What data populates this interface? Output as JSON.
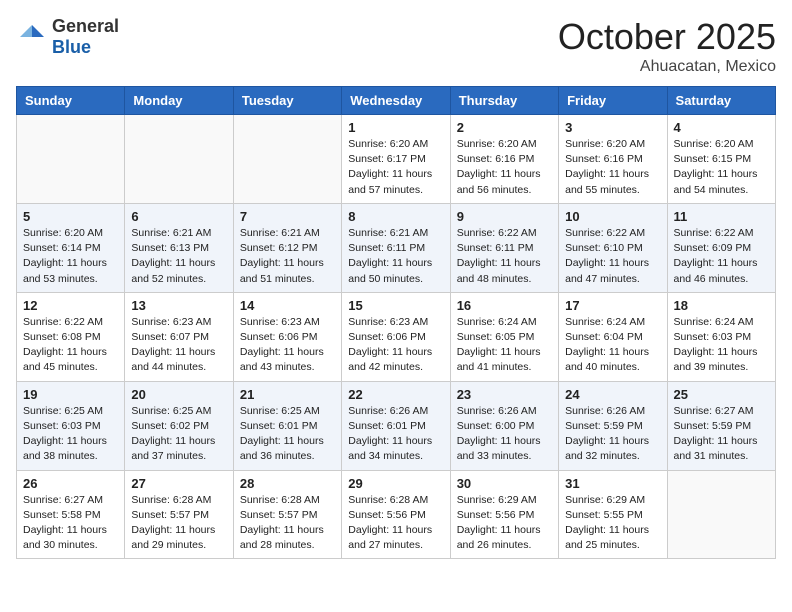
{
  "header": {
    "logo_general": "General",
    "logo_blue": "Blue",
    "month": "October 2025",
    "location": "Ahuacatan, Mexico"
  },
  "days_of_week": [
    "Sunday",
    "Monday",
    "Tuesday",
    "Wednesday",
    "Thursday",
    "Friday",
    "Saturday"
  ],
  "weeks": [
    [
      {
        "day": "",
        "sunrise": "",
        "sunset": "",
        "daylight": ""
      },
      {
        "day": "",
        "sunrise": "",
        "sunset": "",
        "daylight": ""
      },
      {
        "day": "",
        "sunrise": "",
        "sunset": "",
        "daylight": ""
      },
      {
        "day": "1",
        "sunrise": "Sunrise: 6:20 AM",
        "sunset": "Sunset: 6:17 PM",
        "daylight": "Daylight: 11 hours and 57 minutes."
      },
      {
        "day": "2",
        "sunrise": "Sunrise: 6:20 AM",
        "sunset": "Sunset: 6:16 PM",
        "daylight": "Daylight: 11 hours and 56 minutes."
      },
      {
        "day": "3",
        "sunrise": "Sunrise: 6:20 AM",
        "sunset": "Sunset: 6:16 PM",
        "daylight": "Daylight: 11 hours and 55 minutes."
      },
      {
        "day": "4",
        "sunrise": "Sunrise: 6:20 AM",
        "sunset": "Sunset: 6:15 PM",
        "daylight": "Daylight: 11 hours and 54 minutes."
      }
    ],
    [
      {
        "day": "5",
        "sunrise": "Sunrise: 6:20 AM",
        "sunset": "Sunset: 6:14 PM",
        "daylight": "Daylight: 11 hours and 53 minutes."
      },
      {
        "day": "6",
        "sunrise": "Sunrise: 6:21 AM",
        "sunset": "Sunset: 6:13 PM",
        "daylight": "Daylight: 11 hours and 52 minutes."
      },
      {
        "day": "7",
        "sunrise": "Sunrise: 6:21 AM",
        "sunset": "Sunset: 6:12 PM",
        "daylight": "Daylight: 11 hours and 51 minutes."
      },
      {
        "day": "8",
        "sunrise": "Sunrise: 6:21 AM",
        "sunset": "Sunset: 6:11 PM",
        "daylight": "Daylight: 11 hours and 50 minutes."
      },
      {
        "day": "9",
        "sunrise": "Sunrise: 6:22 AM",
        "sunset": "Sunset: 6:11 PM",
        "daylight": "Daylight: 11 hours and 48 minutes."
      },
      {
        "day": "10",
        "sunrise": "Sunrise: 6:22 AM",
        "sunset": "Sunset: 6:10 PM",
        "daylight": "Daylight: 11 hours and 47 minutes."
      },
      {
        "day": "11",
        "sunrise": "Sunrise: 6:22 AM",
        "sunset": "Sunset: 6:09 PM",
        "daylight": "Daylight: 11 hours and 46 minutes."
      }
    ],
    [
      {
        "day": "12",
        "sunrise": "Sunrise: 6:22 AM",
        "sunset": "Sunset: 6:08 PM",
        "daylight": "Daylight: 11 hours and 45 minutes."
      },
      {
        "day": "13",
        "sunrise": "Sunrise: 6:23 AM",
        "sunset": "Sunset: 6:07 PM",
        "daylight": "Daylight: 11 hours and 44 minutes."
      },
      {
        "day": "14",
        "sunrise": "Sunrise: 6:23 AM",
        "sunset": "Sunset: 6:06 PM",
        "daylight": "Daylight: 11 hours and 43 minutes."
      },
      {
        "day": "15",
        "sunrise": "Sunrise: 6:23 AM",
        "sunset": "Sunset: 6:06 PM",
        "daylight": "Daylight: 11 hours and 42 minutes."
      },
      {
        "day": "16",
        "sunrise": "Sunrise: 6:24 AM",
        "sunset": "Sunset: 6:05 PM",
        "daylight": "Daylight: 11 hours and 41 minutes."
      },
      {
        "day": "17",
        "sunrise": "Sunrise: 6:24 AM",
        "sunset": "Sunset: 6:04 PM",
        "daylight": "Daylight: 11 hours and 40 minutes."
      },
      {
        "day": "18",
        "sunrise": "Sunrise: 6:24 AM",
        "sunset": "Sunset: 6:03 PM",
        "daylight": "Daylight: 11 hours and 39 minutes."
      }
    ],
    [
      {
        "day": "19",
        "sunrise": "Sunrise: 6:25 AM",
        "sunset": "Sunset: 6:03 PM",
        "daylight": "Daylight: 11 hours and 38 minutes."
      },
      {
        "day": "20",
        "sunrise": "Sunrise: 6:25 AM",
        "sunset": "Sunset: 6:02 PM",
        "daylight": "Daylight: 11 hours and 37 minutes."
      },
      {
        "day": "21",
        "sunrise": "Sunrise: 6:25 AM",
        "sunset": "Sunset: 6:01 PM",
        "daylight": "Daylight: 11 hours and 36 minutes."
      },
      {
        "day": "22",
        "sunrise": "Sunrise: 6:26 AM",
        "sunset": "Sunset: 6:01 PM",
        "daylight": "Daylight: 11 hours and 34 minutes."
      },
      {
        "day": "23",
        "sunrise": "Sunrise: 6:26 AM",
        "sunset": "Sunset: 6:00 PM",
        "daylight": "Daylight: 11 hours and 33 minutes."
      },
      {
        "day": "24",
        "sunrise": "Sunrise: 6:26 AM",
        "sunset": "Sunset: 5:59 PM",
        "daylight": "Daylight: 11 hours and 32 minutes."
      },
      {
        "day": "25",
        "sunrise": "Sunrise: 6:27 AM",
        "sunset": "Sunset: 5:59 PM",
        "daylight": "Daylight: 11 hours and 31 minutes."
      }
    ],
    [
      {
        "day": "26",
        "sunrise": "Sunrise: 6:27 AM",
        "sunset": "Sunset: 5:58 PM",
        "daylight": "Daylight: 11 hours and 30 minutes."
      },
      {
        "day": "27",
        "sunrise": "Sunrise: 6:28 AM",
        "sunset": "Sunset: 5:57 PM",
        "daylight": "Daylight: 11 hours and 29 minutes."
      },
      {
        "day": "28",
        "sunrise": "Sunrise: 6:28 AM",
        "sunset": "Sunset: 5:57 PM",
        "daylight": "Daylight: 11 hours and 28 minutes."
      },
      {
        "day": "29",
        "sunrise": "Sunrise: 6:28 AM",
        "sunset": "Sunset: 5:56 PM",
        "daylight": "Daylight: 11 hours and 27 minutes."
      },
      {
        "day": "30",
        "sunrise": "Sunrise: 6:29 AM",
        "sunset": "Sunset: 5:56 PM",
        "daylight": "Daylight: 11 hours and 26 minutes."
      },
      {
        "day": "31",
        "sunrise": "Sunrise: 6:29 AM",
        "sunset": "Sunset: 5:55 PM",
        "daylight": "Daylight: 11 hours and 25 minutes."
      },
      {
        "day": "",
        "sunrise": "",
        "sunset": "",
        "daylight": ""
      }
    ]
  ]
}
